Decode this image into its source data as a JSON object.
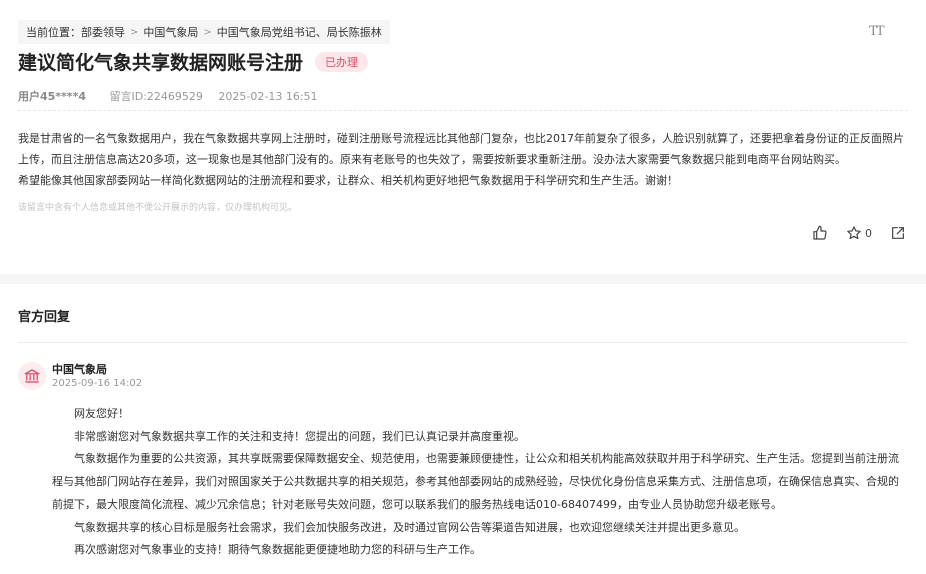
{
  "breadcrumb": {
    "prefix": "当前位置：",
    "items": [
      "部委领导",
      "中国气象局",
      "中国气象局党组书记、局长陈振林"
    ],
    "separator": ">"
  },
  "toolbar": {
    "font_size_label": "TT"
  },
  "message": {
    "title": "建议简化气象共享数据网账号注册",
    "status": "已办理",
    "user": "用户45****4",
    "message_id": "留言ID:22469529",
    "datetime": "2025-02-13 16:51",
    "paragraphs": [
      "我是甘肃省的一名气象数据用户，我在气象数据共享网上注册时，碰到注册账号流程远比其他部门复杂，也比2017年前复杂了很多，人脸识别就算了，还要把拿着身份证的正反面照片上传，而且注册信息高达20多项，这一现象也是其他部门没有的。原来有老账号的也失效了，需要按新要求重新注册。没办法大家需要气象数据只能到电商平台网站购买。",
      "希望能像其他国家部委网站一样简化数据网站的注册流程和要求，让群众、相关机构更好地把气象数据用于科学研究和生产生活。谢谢！"
    ],
    "privacy_note": "该留言中含有个人信息或其他不便公开展示的内容，仅办理机构可见。",
    "star_count": "0"
  },
  "icons": {
    "like": "thumbs-up-icon",
    "star": "star-icon",
    "share": "share-icon",
    "org": "government-building-icon"
  },
  "colors": {
    "badge_bg": "#fde7ea",
    "badge_text": "#e14a63",
    "avatar_bg": "#fdecee",
    "avatar_icon": "#e0506b"
  },
  "official_reply": {
    "section_title": "官方回复",
    "org_name": "中国气象局",
    "date": "2025-09-16 14:02",
    "greeting": "网友您好！",
    "paragraphs": [
      "非常感谢您对气象数据共享工作的关注和支持！您提出的问题，我们已认真记录并高度重视。",
      "气象数据作为重要的公共资源，其共享既需要保障数据安全、规范使用，也需要兼顾便捷性，让公众和相关机构能高效获取并用于科学研究、生产生活。您提到当前注册流程与其他部门网站存在差异，我们对照国家关于公共数据共享的相关规范，参考其他部委网站的成熟经验，尽快优化身份信息采集方式、注册信息项，在确保信息真实、合规的前提下，最大限度简化流程、减少冗余信息；针对老账号失效问题，您可以联系我们的服务热线电话010-68407499，由专业人员协助您升级老账号。",
      "气象数据共享的核心目标是服务社会需求，我们会加快服务改进，及时通过官网公告等渠道告知进展，也欢迎您继续关注并提出更多意见。",
      "再次感谢您对气象事业的支持！期待气象数据能更便捷地助力您的科研与生产工作。"
    ]
  }
}
